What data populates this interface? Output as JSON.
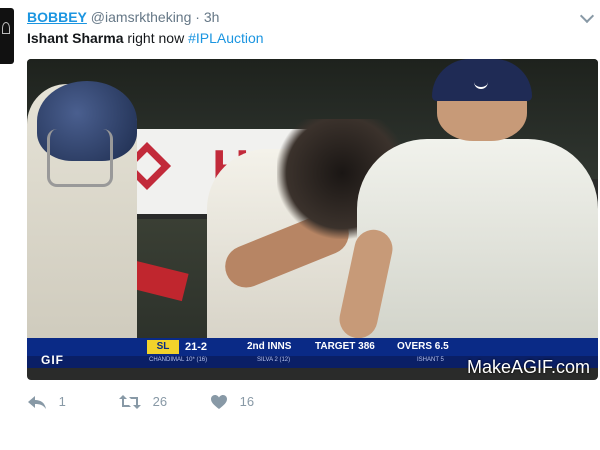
{
  "tweet": {
    "user_name": "BOBBEY",
    "handle": "@iamsrktheking",
    "separator": "·",
    "time": "3h",
    "text_bold": "Ishant Sharma",
    "text_rest": " right now ",
    "hashtag": "#IPLAuction"
  },
  "media": {
    "board_letter": "H",
    "scorebar": {
      "team": "SL",
      "runs": "21-2",
      "innings": "2nd INNS",
      "target": "TARGET 386",
      "overs": "OVERS 6.5"
    },
    "lower_bar": {
      "gif_label": "GIF",
      "batsman1": "CHANDIMAL 10* (16)",
      "batsman2": "SILVA 2 (12)",
      "bowler": "ISHANT 5"
    },
    "watermark": "MakeAGIF.com"
  },
  "actions": {
    "reply_count": "1",
    "retweet_count": "26",
    "like_count": "16"
  },
  "colors": {
    "link": "#1b95e0",
    "muted": "#657786",
    "icon": "#8899a6",
    "score_blue": "#0a2a86",
    "team_yellow": "#f2d22b"
  },
  "icons": [
    "reply-icon",
    "retweet-icon",
    "heart-icon",
    "chevron-down-icon"
  ]
}
